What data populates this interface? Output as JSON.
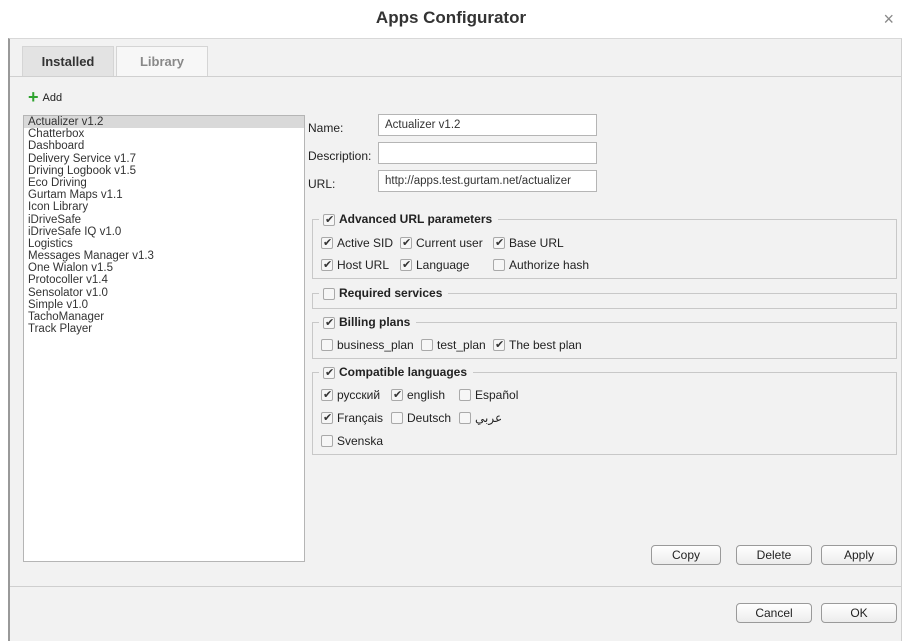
{
  "window": {
    "title": "Apps Configurator",
    "close_icon": "×"
  },
  "tabs": [
    {
      "label": "Installed",
      "active": true
    },
    {
      "label": "Library",
      "active": false
    }
  ],
  "add_button": {
    "icon": "+",
    "label": "Add"
  },
  "apps": [
    "Actualizer v1.2",
    "Chatterbox",
    "Dashboard",
    "Delivery Service v1.7",
    "Driving Logbook v1.5",
    "Eco Driving",
    "Gurtam Maps v1.1",
    "Icon Library",
    "iDriveSafe",
    "iDriveSafe IQ v1.0",
    "Logistics",
    "Messages Manager v1.3",
    "One Wialon v1.5",
    "Protocoller v1.4",
    "Sensolator v1.0",
    "Simple v1.0",
    "TachoManager",
    "Track Player"
  ],
  "selected_app_index": 0,
  "form": {
    "name_label": "Name:",
    "name_value": "Actualizer v1.2",
    "description_label": "Description:",
    "description_value": "",
    "url_label": "URL:",
    "url_value": "http://apps.test.gurtam.net/actualizer"
  },
  "groups": {
    "advanced": {
      "title": "Advanced URL parameters",
      "checked": true,
      "options": [
        {
          "label": "Active SID",
          "checked": true
        },
        {
          "label": "Current user",
          "checked": true
        },
        {
          "label": "Base URL",
          "checked": true
        },
        {
          "label": "Host URL",
          "checked": true
        },
        {
          "label": "Language",
          "checked": true
        },
        {
          "label": "Authorize hash",
          "checked": false
        }
      ]
    },
    "services": {
      "title": "Required services",
      "checked": false
    },
    "billing": {
      "title": "Billing plans",
      "checked": true,
      "options": [
        {
          "label": "business_plan",
          "checked": false
        },
        {
          "label": "test_plan",
          "checked": false
        },
        {
          "label": "The best plan",
          "checked": true
        }
      ]
    },
    "languages": {
      "title": "Compatible languages",
      "checked": true,
      "options": [
        {
          "label": "русский",
          "checked": true
        },
        {
          "label": "english",
          "checked": true
        },
        {
          "label": "Español",
          "checked": false
        },
        {
          "label": "Français",
          "checked": true
        },
        {
          "label": "Deutsch",
          "checked": false
        },
        {
          "label": "عربي",
          "checked": false
        },
        {
          "label": "Svenska",
          "checked": false
        }
      ]
    }
  },
  "action_buttons": {
    "copy": "Copy",
    "delete": "Delete",
    "apply": "Apply"
  },
  "footer_buttons": {
    "cancel": "Cancel",
    "ok": "OK"
  }
}
